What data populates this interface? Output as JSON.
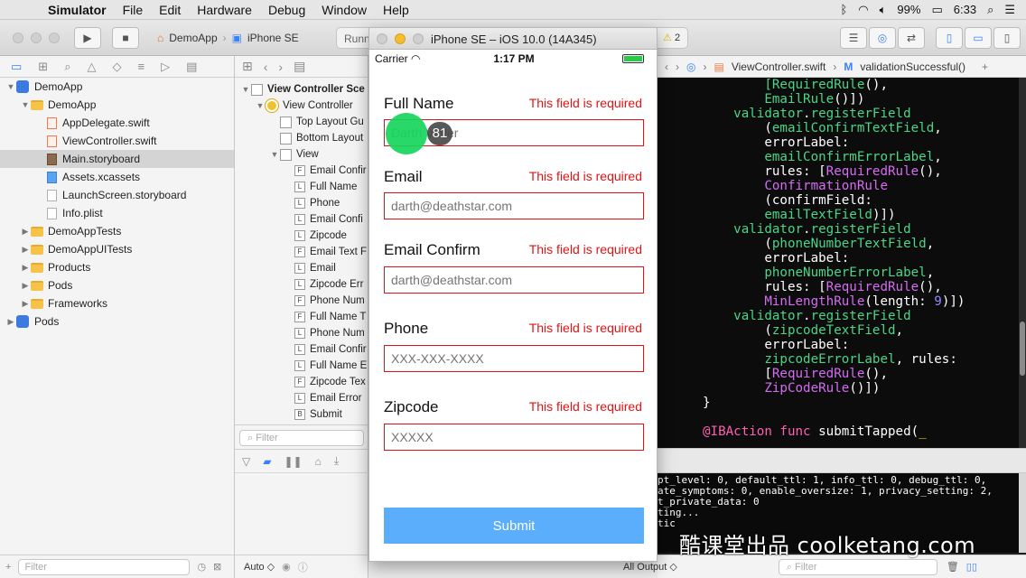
{
  "menubar": {
    "app": "Simulator",
    "items": [
      "File",
      "Edit",
      "Hardware",
      "Debug",
      "Window",
      "Help"
    ],
    "battery": "99%",
    "clock": "6:33"
  },
  "toolbar": {
    "scheme": "DemoApp",
    "device": "iPhone SE",
    "status": "Runni",
    "warnings": "2"
  },
  "navigator": {
    "items": [
      {
        "label": "DemoApp",
        "kind": "project",
        "depth": 0,
        "disclosure": "▼"
      },
      {
        "label": "DemoApp",
        "kind": "folder",
        "depth": 1,
        "disclosure": "▼"
      },
      {
        "label": "AppDelegate.swift",
        "kind": "swift",
        "depth": 2,
        "disclosure": ""
      },
      {
        "label": "ViewController.swift",
        "kind": "swift",
        "depth": 2,
        "disclosure": ""
      },
      {
        "label": "Main.storyboard",
        "kind": "sb",
        "depth": 2,
        "disclosure": "",
        "selected": true
      },
      {
        "label": "Assets.xcassets",
        "kind": "asset",
        "depth": 2,
        "disclosure": ""
      },
      {
        "label": "LaunchScreen.storyboard",
        "kind": "file",
        "depth": 2,
        "disclosure": ""
      },
      {
        "label": "Info.plist",
        "kind": "file",
        "depth": 2,
        "disclosure": ""
      },
      {
        "label": "DemoAppTests",
        "kind": "folder",
        "depth": 1,
        "disclosure": "▶"
      },
      {
        "label": "DemoAppUITests",
        "kind": "folder",
        "depth": 1,
        "disclosure": "▶"
      },
      {
        "label": "Products",
        "kind": "folder",
        "depth": 1,
        "disclosure": "▶"
      },
      {
        "label": "Pods",
        "kind": "folder",
        "depth": 1,
        "disclosure": "▶"
      },
      {
        "label": "Frameworks",
        "kind": "folder",
        "depth": 1,
        "disclosure": "▶"
      },
      {
        "label": "Pods",
        "kind": "project",
        "depth": 0,
        "disclosure": "▶"
      }
    ],
    "filter_placeholder": "Filter"
  },
  "outline": {
    "items": [
      {
        "label": "View Controller Sce",
        "icon": "scene",
        "depth": 0,
        "disclosure": "▼",
        "bold": true
      },
      {
        "label": "View Controller",
        "icon": "vc",
        "depth": 1,
        "disclosure": "▼"
      },
      {
        "label": "Top Layout Gu",
        "icon": "view",
        "depth": 2,
        "disclosure": ""
      },
      {
        "label": "Bottom Layout",
        "icon": "view",
        "depth": 2,
        "disclosure": ""
      },
      {
        "label": "View",
        "icon": "view",
        "depth": 2,
        "disclosure": "▼"
      },
      {
        "label": "Email Confir",
        "icon": "F",
        "depth": 3,
        "disclosure": ""
      },
      {
        "label": "Full Name",
        "icon": "L",
        "depth": 3,
        "disclosure": ""
      },
      {
        "label": "Phone",
        "icon": "L",
        "depth": 3,
        "disclosure": ""
      },
      {
        "label": "Email Confi",
        "icon": "L",
        "depth": 3,
        "disclosure": ""
      },
      {
        "label": "Zipcode",
        "icon": "L",
        "depth": 3,
        "disclosure": ""
      },
      {
        "label": "Email Text F",
        "icon": "F",
        "depth": 3,
        "disclosure": ""
      },
      {
        "label": "Email",
        "icon": "L",
        "depth": 3,
        "disclosure": ""
      },
      {
        "label": "Zipcode Err",
        "icon": "L",
        "depth": 3,
        "disclosure": ""
      },
      {
        "label": "Phone Num",
        "icon": "F",
        "depth": 3,
        "disclosure": ""
      },
      {
        "label": "Full Name T",
        "icon": "F",
        "depth": 3,
        "disclosure": ""
      },
      {
        "label": "Phone Num",
        "icon": "L",
        "depth": 3,
        "disclosure": ""
      },
      {
        "label": "Email Confir",
        "icon": "L",
        "depth": 3,
        "disclosure": ""
      },
      {
        "label": "Full Name E",
        "icon": "L",
        "depth": 3,
        "disclosure": ""
      },
      {
        "label": "Zipcode Tex",
        "icon": "F",
        "depth": 3,
        "disclosure": ""
      },
      {
        "label": "Email Error",
        "icon": "L",
        "depth": 3,
        "disclosure": ""
      },
      {
        "label": "Submit",
        "icon": "B",
        "depth": 3,
        "disclosure": ""
      }
    ],
    "filter_placeholder": "Filter",
    "auto_label": "Auto ◇"
  },
  "simulator": {
    "title": "iPhone SE – iOS 10.0 (14A345)",
    "carrier": "Carrier",
    "time": "1:17 PM",
    "fields": [
      {
        "label": "Full Name",
        "error": "This field is required",
        "placeholder": "Darth Vader"
      },
      {
        "label": "Email",
        "error": "This field is required",
        "placeholder": "darth@deathstar.com"
      },
      {
        "label": "Email Confirm",
        "error": "This field is required",
        "placeholder": "darth@deathstar.com"
      },
      {
        "label": "Phone",
        "error": "This field is required",
        "placeholder": "XXX-XXX-XXXX"
      },
      {
        "label": "Zipcode",
        "error": "This field is required",
        "placeholder": "XXXXX"
      }
    ],
    "submit_label": "Submit",
    "touch_badge": "81"
  },
  "editor": {
    "jump_file": "ViewController.swift",
    "jump_symbol": "validationSuccessful()",
    "console_output_label": "All Output ◇",
    "filter_placeholder": "Filter",
    "console_lines": [
      "pt_level: 0, default_ttl: 1, info_ttl: 0, debug_ttl: 0,",
      "ate_symptoms: 0, enable_oversize: 1, privacy_setting: 2,",
      "t_private_data: 0",
      "ting...",
      "tic"
    ]
  },
  "watermark": "酷课堂出品 coolketang.com"
}
